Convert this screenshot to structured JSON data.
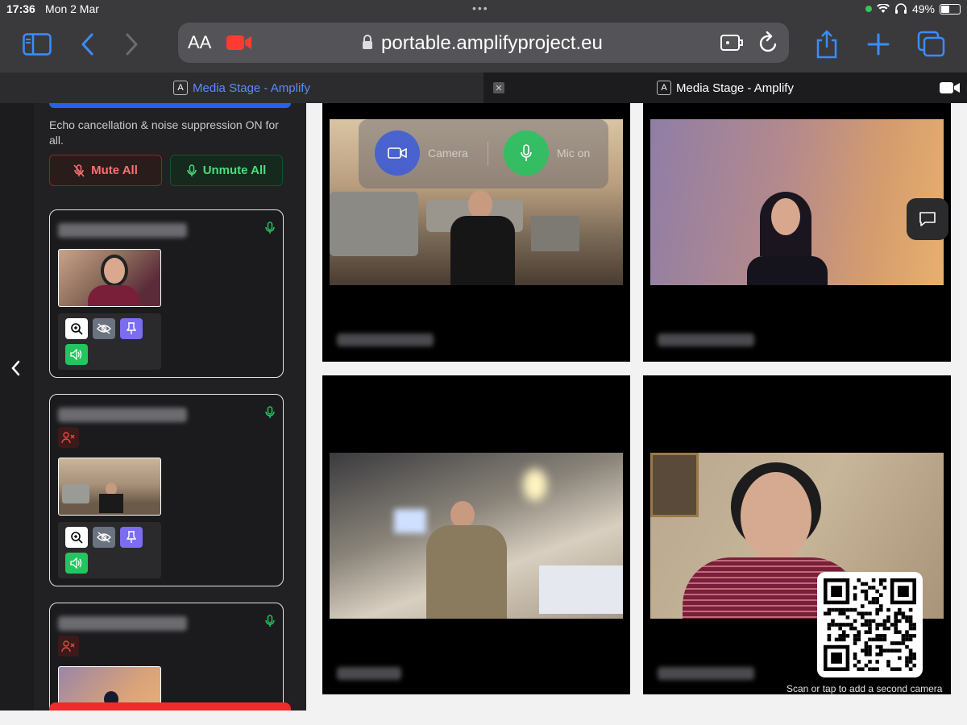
{
  "status_bar": {
    "time": "17:36",
    "date": "Mon 2 Mar",
    "battery": "49%",
    "battery_level": 0.49
  },
  "browser": {
    "aa_label": "AA",
    "url": "portable.amplifyproject.eu"
  },
  "tabs": [
    {
      "label": "Media Stage - Amplify",
      "badge": "A",
      "active": true
    },
    {
      "label": "Media Stage - Amplify",
      "badge": "A",
      "active": false
    }
  ],
  "sidebar": {
    "echo_text": "Echo cancellation & noise suppression ON for all.",
    "mute_all_label": "Mute All",
    "unmute_all_label": "Unmute All"
  },
  "overlay": {
    "camera_label": "Camera",
    "mic_label": "Mic on"
  },
  "qr": {
    "caption": "Scan or tap to add a second camera"
  },
  "colors": {
    "accent_blue": "#2563eb",
    "danger": "#ef2b2b",
    "success": "#22c55e",
    "tab_active": "#5b8cf5"
  }
}
